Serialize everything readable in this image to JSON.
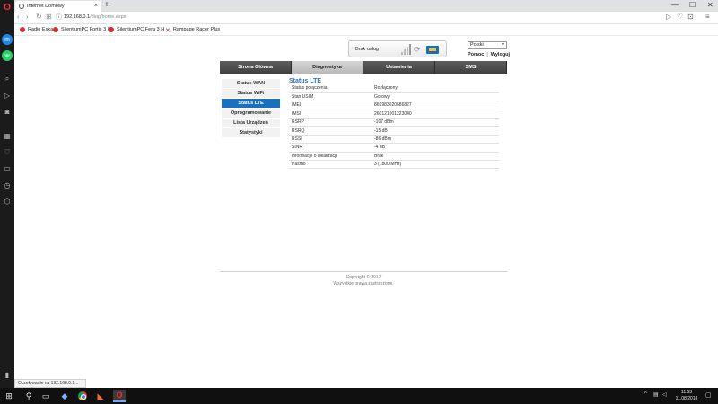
{
  "browser": {
    "tab_title": "Internet Domowy",
    "tab_close": "×",
    "new_tab": "+",
    "url_host": "192.168.0.1",
    "url_path": "/diag/home.aspx",
    "window_controls": {
      "minimize": "—",
      "maximize": "☐",
      "close": "✕"
    },
    "nav": {
      "back": "‹",
      "forward": "›",
      "reload": "↻",
      "tabs": "⊞"
    },
    "address_right": {
      "send": "▷",
      "heart": "♡",
      "snapshot": "⊡",
      "menu": "≡"
    }
  },
  "bookmarks": [
    {
      "label": "Radio Eska",
      "icon": "radio-icon"
    },
    {
      "label": "SilentiumPC Fortis 3 H",
      "icon": "silentium-icon"
    },
    {
      "label": "SilentiumPC Fera 3 H",
      "icon": "silentium-icon"
    },
    {
      "label": "Rampage Racer Plus",
      "icon": "x-icon"
    }
  ],
  "header": {
    "service_text": "Brak usług",
    "language": "Polski",
    "help_label": "Pomoc",
    "separator": "|",
    "logout_label": "Wyloguj"
  },
  "main_nav": [
    {
      "label": "Strona Główna",
      "active": false
    },
    {
      "label": "Diagnostyka",
      "active": true
    },
    {
      "label": "Ustawienia",
      "active": false
    },
    {
      "label": "SMS",
      "active": false
    }
  ],
  "side_menu": [
    {
      "label": "Status WAN",
      "active": false,
      "sub": true
    },
    {
      "label": "Status WiFi",
      "active": false,
      "sub": true
    },
    {
      "label": "Status LTE",
      "active": true,
      "sub": true
    },
    {
      "label": "Oprogramowanie",
      "active": false,
      "sub": false
    },
    {
      "label": "Lista Urządzeń",
      "active": false,
      "sub": false
    },
    {
      "label": "Statystyki",
      "active": false,
      "sub": false
    }
  ],
  "content": {
    "title": "Status LTE",
    "rows": [
      {
        "label": "Status połączenia",
        "value": "Rozłączony"
      },
      {
        "label": "Stan USIM",
        "value": "Gotowy"
      },
      {
        "label": "IMEI",
        "value": "869983020686827"
      },
      {
        "label": "IMSI",
        "value": "260121001223040"
      },
      {
        "label": "RSRP",
        "value": "-107 dBm"
      },
      {
        "label": "RSRQ",
        "value": "-15 dB"
      },
      {
        "label": "RSSI",
        "value": "-86 dBm"
      },
      {
        "label": "SINR",
        "value": "-4 dB"
      },
      {
        "label": "Informacje o lokalizacji",
        "value": "Brak"
      },
      {
        "label": "Pasmo",
        "value": "3 (1800 MHz)"
      }
    ]
  },
  "footer": {
    "copyright": "Copyright © 2017",
    "rights": "Wszystkie prawa zastrzeżone."
  },
  "statusbar": {
    "text": "Oczekiwanie na 192.168.0.1..."
  },
  "taskbar": {
    "time": "11:53",
    "date": "11.08.2018"
  }
}
